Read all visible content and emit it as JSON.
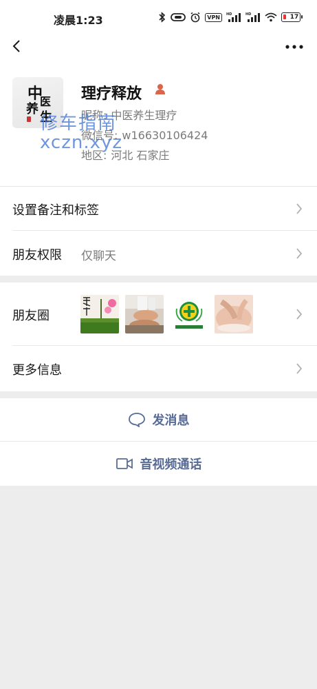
{
  "status_bar": {
    "time": "凌晨1:23",
    "vpn": "VPN",
    "battery": "17",
    "battery_level": 0.17,
    "icons": [
      "bluetooth-icon",
      "alarm-icon",
      "vpn-icon",
      "signal-hd-1-icon",
      "signal-hd-2-icon",
      "wifi-icon",
      "battery-icon"
    ]
  },
  "nav": {
    "back_icon": "chevron-left-icon",
    "more_icon": "more-dots-icon"
  },
  "profile": {
    "avatar_chars": [
      "中",
      "医",
      "养",
      "生"
    ],
    "name": "理疗释放",
    "gender_icon": "person-icon",
    "nickname_label": "昵称:",
    "nickname": "中医养生理疗",
    "wechat_label": "微信号:",
    "wechat_id": "w16630106424",
    "region_label": "地区:",
    "region": "河北  石家庄"
  },
  "watermark": {
    "line1": "修车指南",
    "line2": "xczn.xyz"
  },
  "settings": {
    "remark_label": "设置备注和标签",
    "permission_label": "朋友权限",
    "permission_value": "仅聊天",
    "moments_label": "朋友圈",
    "more_info_label": "更多信息"
  },
  "actions": {
    "message_label": "发消息",
    "message_icon": "chat-bubble-icon",
    "call_label": "音视频通话",
    "call_icon": "video-call-icon"
  },
  "colors": {
    "background": "#ededed",
    "card": "#ffffff",
    "link_blue": "#576b95",
    "secondary_text": "#7a7a7a",
    "watermark": "#4a7bd8",
    "gender_icon": "#d9654a"
  }
}
